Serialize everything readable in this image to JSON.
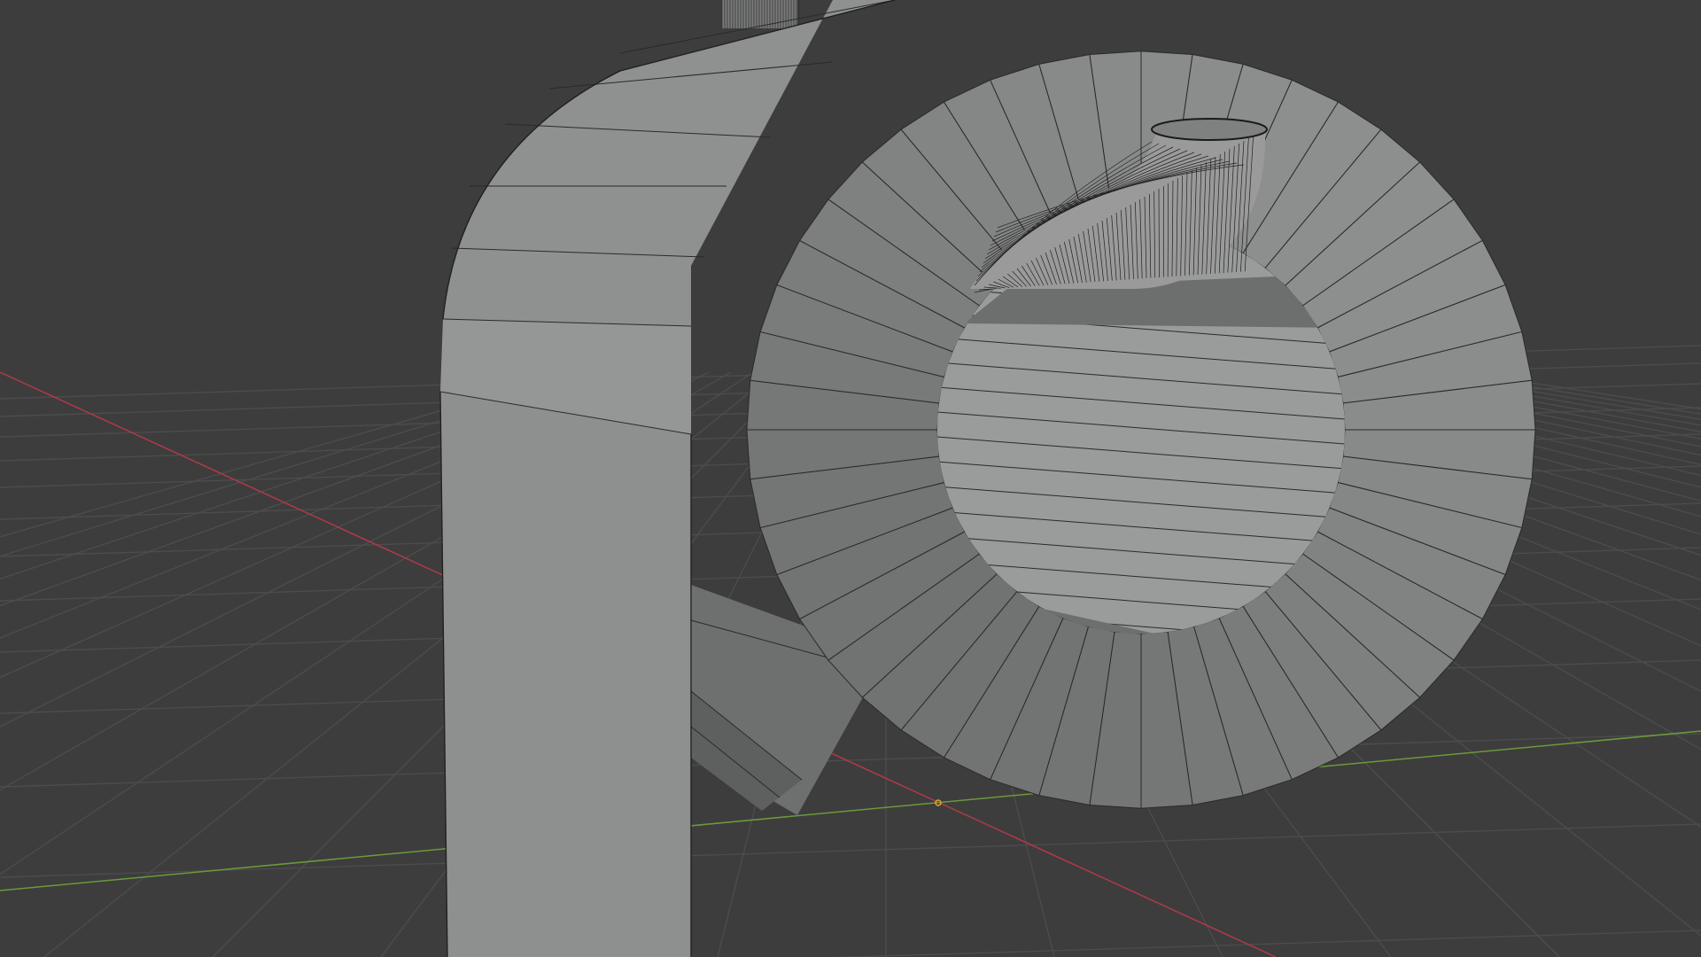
{
  "app": {
    "name": "3D viewport",
    "view_mode": "solid",
    "overlay": "wireframe-edges"
  },
  "colors": {
    "background": "#3d3d3d",
    "grid": "#4c4c4c",
    "axis_x": "#b03a48",
    "axis_y": "#6a9a3a",
    "mesh_face": "#8e8f8f",
    "mesh_face_light": "#9a9b9b",
    "mesh_face_shadow": "#6d6e6e",
    "mesh_edge": "#2a2a2a",
    "origin_marker": "#e8a23a"
  },
  "icons": {
    "origin": "object-origin-icon"
  },
  "scene": {
    "objects": [
      {
        "id": "pipe-bend-large",
        "kind": "mesh",
        "shading": "solid-gray"
      },
      {
        "id": "pipe-elbow-small",
        "kind": "mesh",
        "shading": "dense-wireframe"
      },
      {
        "id": "pipe-stub-top",
        "kind": "mesh",
        "shading": "dense-wireframe"
      }
    ],
    "floor_grid": true,
    "axes_visible": [
      "x",
      "y"
    ]
  }
}
